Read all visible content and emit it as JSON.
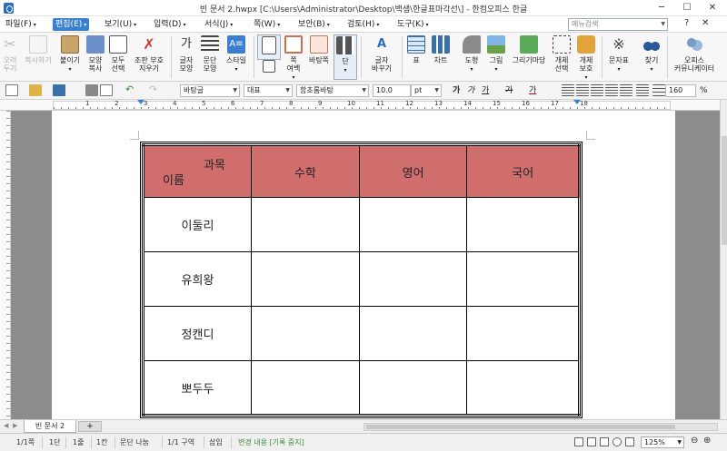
{
  "window": {
    "title": "빈 문서 2.hwpx [C:\\Users\\Administrator\\Desktop\\백샘\\한글표마각선\\] - 한컴오피스 한글"
  },
  "menubar": {
    "items": [
      "파일(F)",
      "편집(E)",
      "보기(U)",
      "입력(D)",
      "서식(J)",
      "쪽(W)",
      "보안(B)",
      "검토(H)",
      "도구(K)"
    ],
    "active_index": 1,
    "search_placeholder": "메뉴검색",
    "help_glyph": "?",
    "close_glyph": "✕"
  },
  "ribbon": {
    "buttons": [
      {
        "label": "오려\n두기",
        "icon": "scissors-icon",
        "disabled": true
      },
      {
        "label": "복사하기",
        "icon": "copy-icon",
        "disabled": true
      },
      {
        "label": "붙이기",
        "icon": "paste-icon",
        "disabled": false
      },
      {
        "label": "모양\n복사",
        "icon": "format-painter-icon",
        "disabled": false
      },
      {
        "label": "모두\n선택",
        "icon": "select-all-icon",
        "disabled": false
      },
      {
        "label": "조판 부호\n지우기",
        "icon": "erase-icon",
        "disabled": false
      },
      {
        "label": "글자\n모양",
        "icon": "char-shape-icon",
        "disabled": false
      },
      {
        "label": "문단\n모양",
        "icon": "para-shape-icon",
        "disabled": false
      },
      {
        "label": "스타일",
        "icon": "style-icon",
        "disabled": false
      },
      {
        "label": "",
        "icon": "page-icon",
        "disabled": false
      },
      {
        "label": "쪽\n여백",
        "icon": "margin-icon",
        "disabled": false
      },
      {
        "label": "바탕쪽",
        "icon": "master-page-icon",
        "disabled": false
      },
      {
        "label": "단",
        "icon": "columns-icon",
        "disabled": false
      },
      {
        "label": "글자\n바꾸기",
        "icon": "replace-char-icon",
        "disabled": false
      },
      {
        "label": "표",
        "icon": "table-icon",
        "disabled": false
      },
      {
        "label": "차트",
        "icon": "chart-icon",
        "disabled": false
      },
      {
        "label": "도형",
        "icon": "shape-icon",
        "disabled": false
      },
      {
        "label": "그림",
        "icon": "picture-icon",
        "disabled": false
      },
      {
        "label": "그리기마당",
        "icon": "clipart-icon",
        "disabled": false
      },
      {
        "label": "개체\n선택",
        "icon": "object-select-icon",
        "disabled": false
      },
      {
        "label": "개체\n보호",
        "icon": "object-lock-icon",
        "disabled": false
      },
      {
        "label": "문자표",
        "icon": "symbol-icon",
        "disabled": false
      },
      {
        "label": "찾기",
        "icon": "binoculars-icon",
        "disabled": false
      },
      {
        "label": "오피스\n커뮤니케이터",
        "icon": "communicator-icon",
        "disabled": false
      }
    ]
  },
  "format_toolbar": {
    "style": "바탕글",
    "script": "대표",
    "font": "함초롬바탕",
    "size": "10.0",
    "unit": "pt",
    "bold": "가",
    "italic": "가",
    "underline": "가",
    "strike": "가",
    "color": "가",
    "line_spacing": "160",
    "line_spacing_unit": "%"
  },
  "ruler": {
    "numbers": [
      "1",
      "2",
      "3",
      "4",
      "5",
      "6",
      "7",
      "8",
      "9",
      "10",
      "11",
      "12",
      "13",
      "14",
      "15",
      "16",
      "17",
      "18"
    ]
  },
  "table": {
    "corner_top": "과목",
    "corner_bottom": "이름",
    "subjects": [
      "수학",
      "영어",
      "국어"
    ],
    "names": [
      "이둘리",
      "유희왕",
      "정캔디",
      "뽀두두"
    ],
    "header_color": "#d06e6e"
  },
  "tabs": {
    "document_tab": "빈 문서 2",
    "add_tab": "+"
  },
  "statusbar": {
    "page": "1/1쪽",
    "section": "1단",
    "line": "1줄",
    "column": "1칸",
    "para_break": "문단 나눔",
    "area": "1/1 구역",
    "insert_mode": "삽입",
    "track_changes": "변경 내용 [기록 중지]",
    "zoom": "125%"
  }
}
